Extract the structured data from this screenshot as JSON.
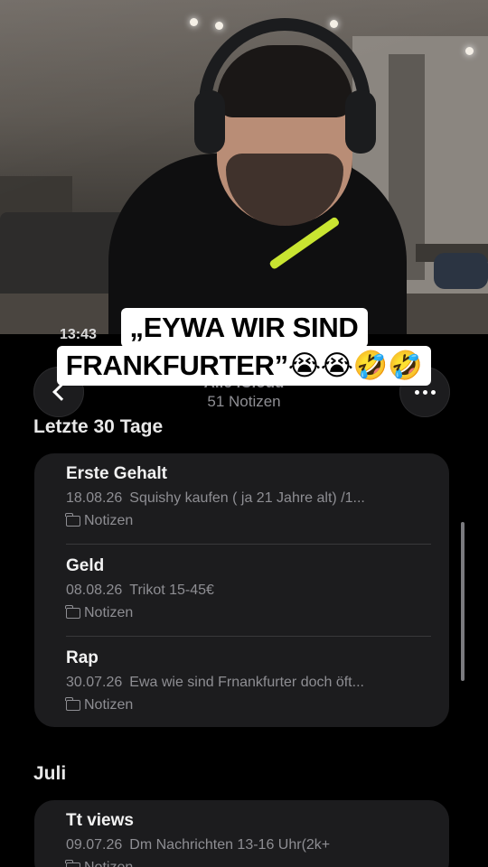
{
  "status_bar": {
    "time": "13:43"
  },
  "caption": {
    "line1": "„EYWA WIR SIND",
    "line2": "FRANKFURTER”😭😭🤣🤣"
  },
  "nav": {
    "back_icon": "chevron-left-icon",
    "more_icon": "ellipsis-icon",
    "folder_title": "Alle iCloud",
    "note_count": "51 Notizen"
  },
  "sections": [
    {
      "header": "Letzte 30 Tage",
      "notes": [
        {
          "title": "Erste Gehalt",
          "date": "18.08.26",
          "preview": "Squishy kaufen ( ja 21 Jahre alt) /1...",
          "folder": "Notizen"
        },
        {
          "title": "Geld",
          "date": "08.08.26",
          "preview": "Trikot 15-45€",
          "folder": "Notizen"
        },
        {
          "title": "Rap",
          "date": "30.07.26",
          "preview": "Ewa wie sind Frnankfurter doch öft...",
          "folder": "Notizen"
        }
      ]
    },
    {
      "header": "Juli",
      "notes": [
        {
          "title": "Tt views",
          "date": "09.07.26",
          "preview": "Dm Nachrichten 13-16 Uhr(2k+",
          "folder": "Notizen"
        }
      ]
    }
  ],
  "colors": {
    "background": "#000000",
    "card": "#1c1c1e",
    "secondary_text": "#8e8e93",
    "caption_bg": "#ffffff",
    "mic_arm": "#c9e531"
  }
}
